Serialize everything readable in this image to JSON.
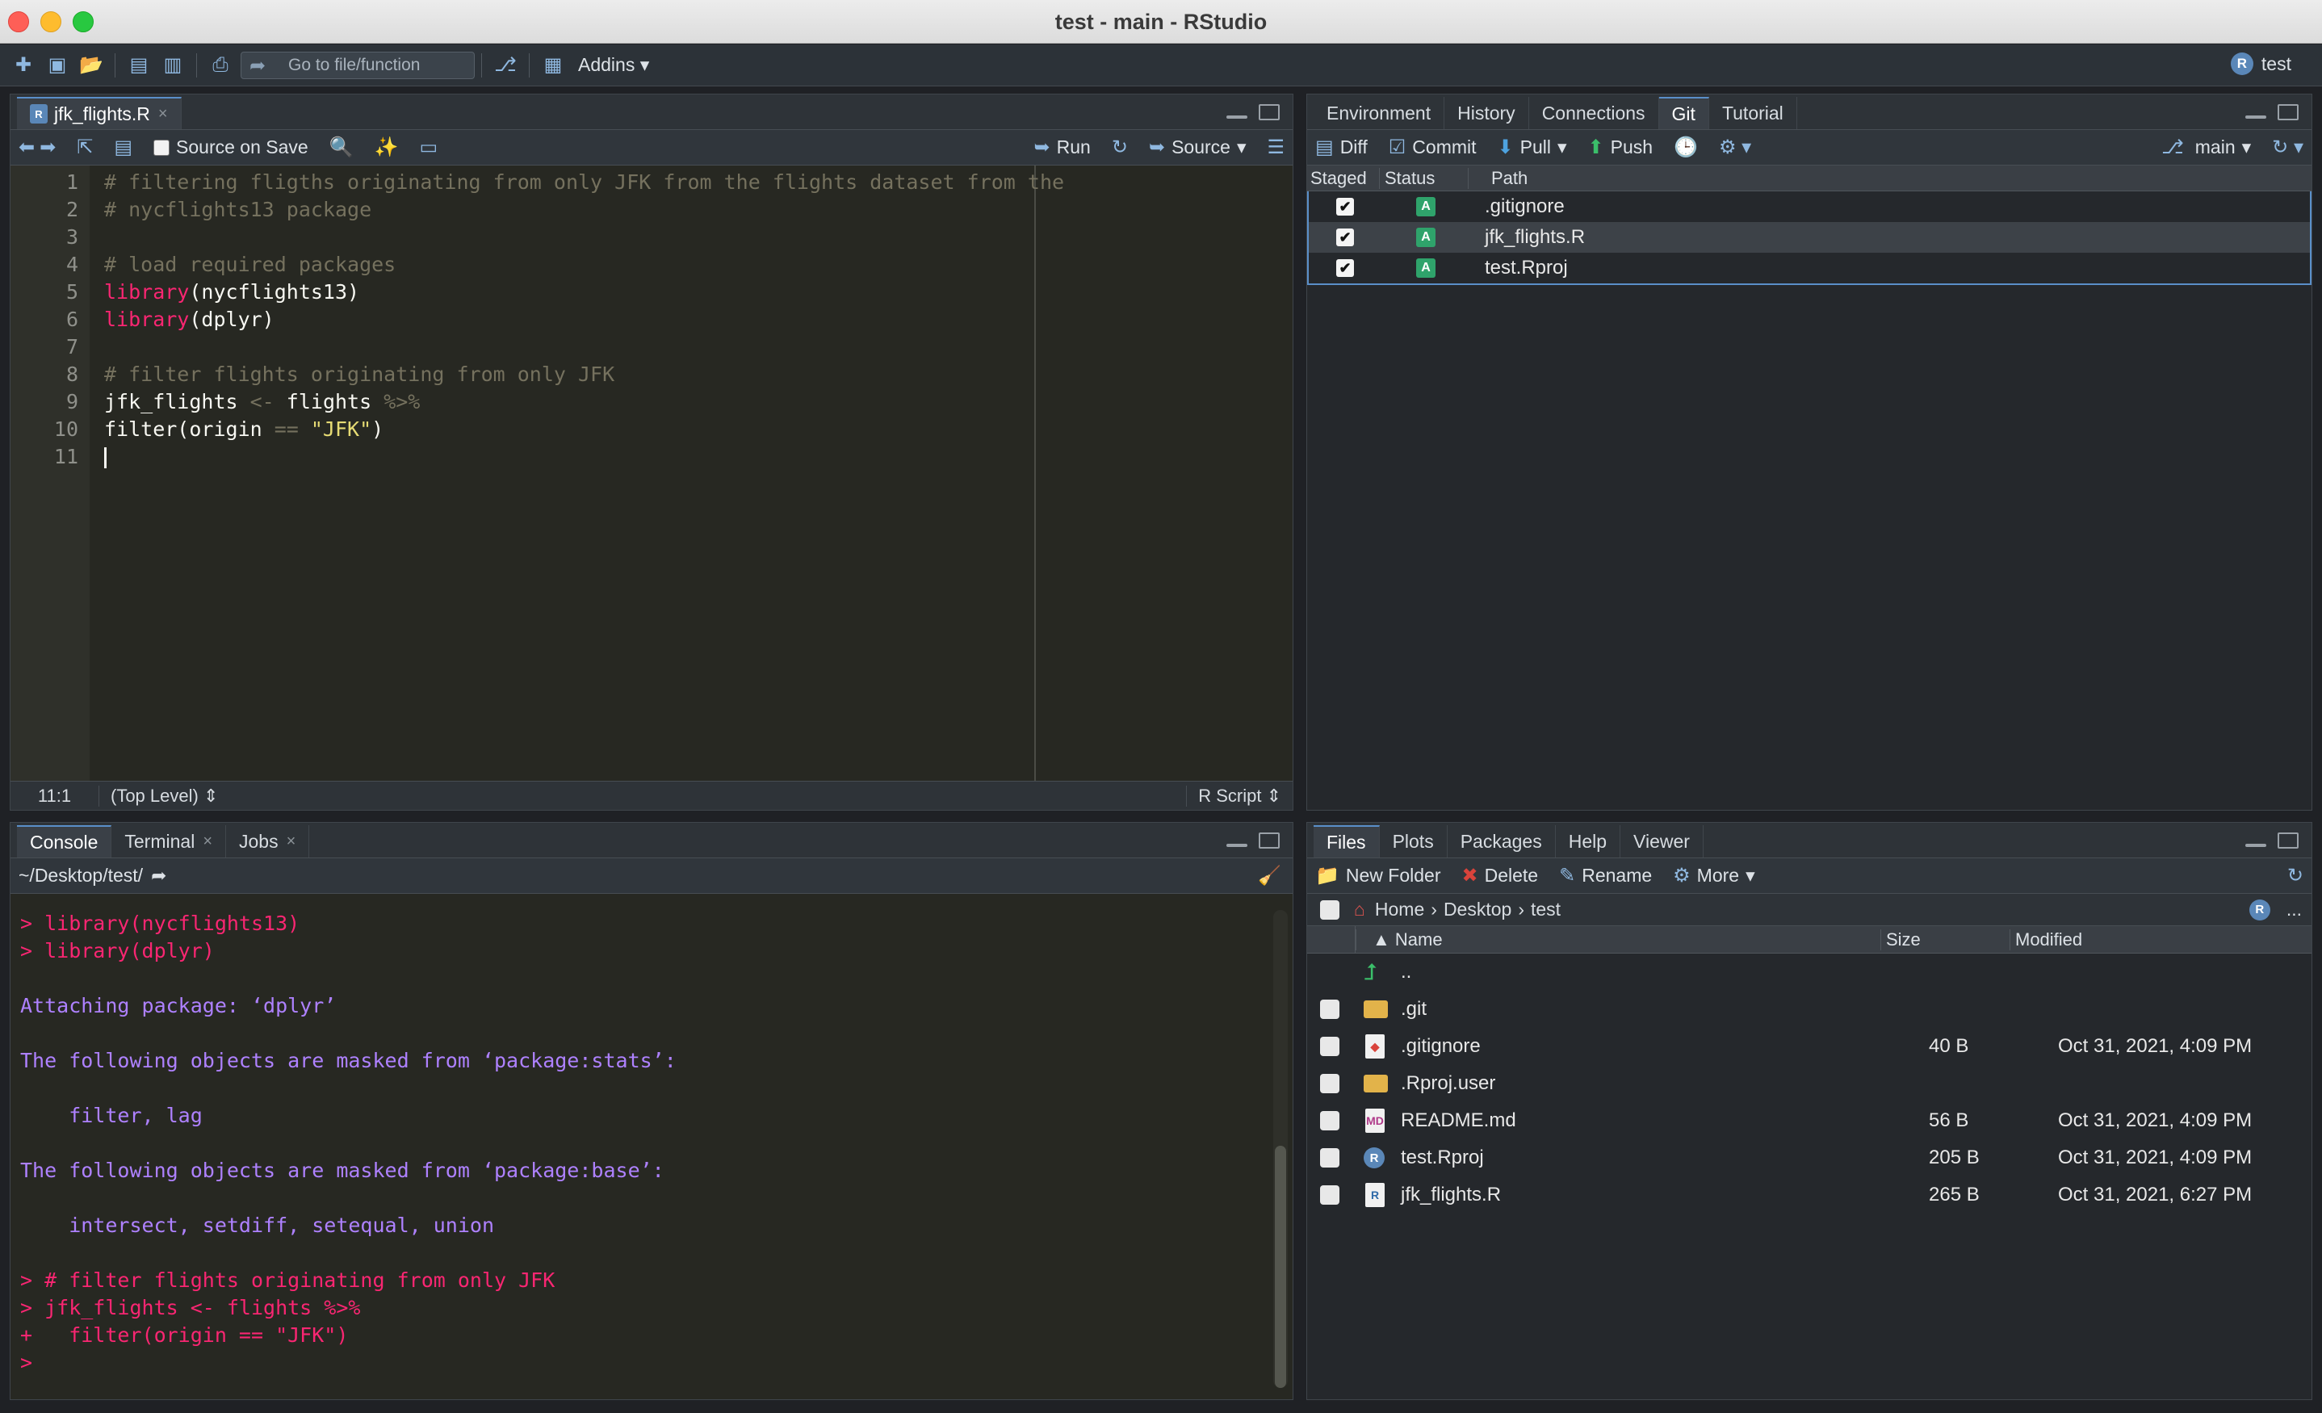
{
  "window": {
    "title": "test - main - RStudio"
  },
  "toolbar": {
    "goto_placeholder": "Go to file/function",
    "addins_label": "Addins",
    "project_label": "test",
    "project_badge": "R"
  },
  "source_pane": {
    "tab_label": "jfk_flights.R",
    "tab_close": "×",
    "source_on_save": "Source on Save",
    "run_label": "Run",
    "source_label": "Source",
    "line_numbers": [
      "1",
      "2",
      "3",
      "4",
      "5",
      "6",
      "7",
      "8",
      "9",
      "10",
      "11"
    ],
    "status_position": "11:1",
    "status_scope": "(Top Level)",
    "status_filetype": "R Script",
    "code": {
      "l1": "# filtering fligths originating from only JFK from the flights dataset from the",
      "l2": "# nycflights13 package",
      "l4": "# load required packages",
      "l5_fn": "library",
      "l5_arg": "(nycflights13)",
      "l6_fn": "library",
      "l6_arg": "(dplyr)",
      "l8": "# filter flights originating from only JFK",
      "l9_a": "jfk_flights ",
      "l9_op": "<-",
      "l9_b": " flights ",
      "l9_pipe": "%>%",
      "l10_a": "  filter(origin ",
      "l10_op": "==",
      "l10_str": " \"JFK\"",
      "l10_b": ")"
    }
  },
  "console_pane": {
    "tabs": [
      {
        "label": "Console"
      },
      {
        "label": "Terminal"
      },
      {
        "label": "Jobs"
      }
    ],
    "path": "~/Desktop/test/",
    "lines": [
      "> library(nycflights13)",
      "> library(dplyr)",
      "",
      "Attaching package: ‘dplyr’",
      "",
      "The following objects are masked from ‘package:stats’:",
      "",
      "    filter, lag",
      "",
      "The following objects are masked from ‘package:base’:",
      "",
      "    intersect, setdiff, setequal, union",
      "",
      "> # filter flights originating from only JFK",
      "> jfk_flights <- flights %>%",
      "+   filter(origin == \"JFK\")",
      "> "
    ]
  },
  "env_pane": {
    "tabs": [
      {
        "label": "Environment"
      },
      {
        "label": "History"
      },
      {
        "label": "Connections"
      },
      {
        "label": "Git"
      },
      {
        "label": "Tutorial"
      }
    ],
    "tools": {
      "diff": "Diff",
      "commit": "Commit",
      "pull": "Pull",
      "push": "Push",
      "branch": "main"
    },
    "columns": {
      "staged": "Staged",
      "status": "Status",
      "path": "Path"
    },
    "files": [
      {
        "status": "A",
        "path": ".gitignore"
      },
      {
        "status": "A",
        "path": "jfk_flights.R"
      },
      {
        "status": "A",
        "path": "test.Rproj"
      }
    ]
  },
  "files_pane": {
    "tabs": [
      {
        "label": "Files"
      },
      {
        "label": "Plots"
      },
      {
        "label": "Packages"
      },
      {
        "label": "Help"
      },
      {
        "label": "Viewer"
      }
    ],
    "tools": {
      "new_folder": "New Folder",
      "delete": "Delete",
      "rename": "Rename",
      "more": "More"
    },
    "breadcrumb": [
      "Home",
      "Desktop",
      "test"
    ],
    "more_dots": "...",
    "columns": {
      "name": "Name",
      "size": "Size",
      "modified": "Modified"
    },
    "parent": "..",
    "rows": [
      {
        "name": ".git",
        "size": "",
        "modified": ""
      },
      {
        "name": ".gitignore",
        "size": "40 B",
        "modified": "Oct 31, 2021, 4:09 PM"
      },
      {
        "name": ".Rproj.user",
        "size": "",
        "modified": ""
      },
      {
        "name": "README.md",
        "size": "56 B",
        "modified": "Oct 31, 2021, 4:09 PM"
      },
      {
        "name": "test.Rproj",
        "size": "205 B",
        "modified": "Oct 31, 2021, 4:09 PM"
      },
      {
        "name": "jfk_flights.R",
        "size": "265 B",
        "modified": "Oct 31, 2021, 6:27 PM"
      }
    ]
  }
}
